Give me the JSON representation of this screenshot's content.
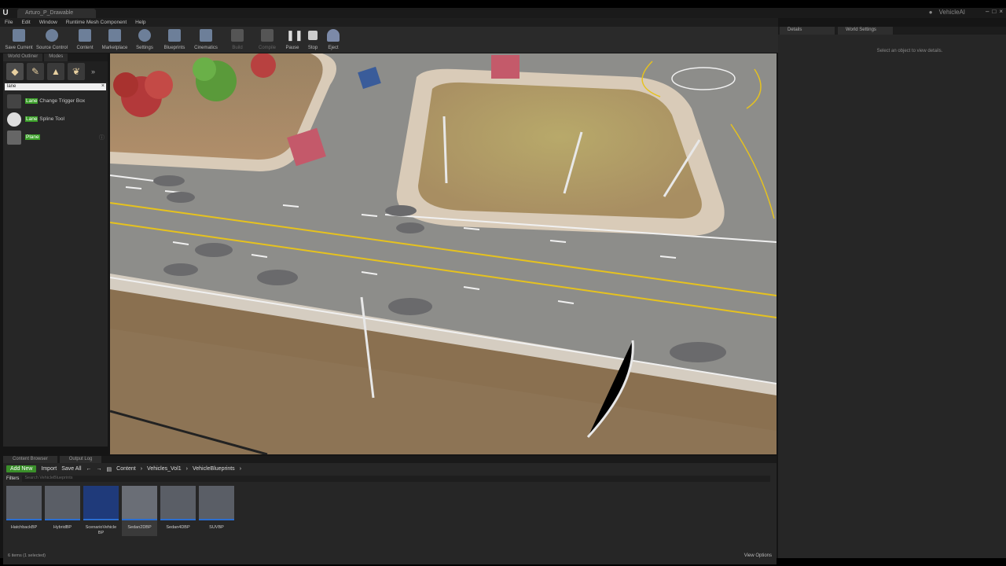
{
  "window": {
    "doc_tab": "Arturo_P_Drawable",
    "project_name": "VehicleAI"
  },
  "menu": [
    "File",
    "Edit",
    "Window",
    "Runtime Mesh Component",
    "Help"
  ],
  "toolbar": [
    {
      "label": "Save Current",
      "icon": "save-icon"
    },
    {
      "label": "Source Control",
      "icon": "source-control-icon"
    },
    {
      "label": "Content",
      "icon": "content-icon"
    },
    {
      "label": "Marketplace",
      "icon": "marketplace-icon"
    },
    {
      "label": "Settings",
      "icon": "settings-icon"
    },
    {
      "label": "Blueprints",
      "icon": "blueprints-icon"
    },
    {
      "label": "Cinematics",
      "icon": "cinematics-icon"
    },
    {
      "label": "Build",
      "icon": "build-icon",
      "disabled": true
    },
    {
      "label": "Compile",
      "icon": "compile-icon",
      "disabled": true
    },
    {
      "label": "Pause",
      "icon": "pause-icon"
    },
    {
      "label": "Stop",
      "icon": "stop-icon"
    },
    {
      "label": "Eject",
      "icon": "eject-icon"
    }
  ],
  "left_panel": {
    "tabs": [
      "World Outliner",
      "Modes"
    ],
    "search_value": "lane",
    "items": [
      {
        "highlight": "Lane",
        "rest": " Change Trigger Box"
      },
      {
        "highlight": "Lane",
        "rest": " Spline Tool"
      },
      {
        "highlight": "Plane",
        "rest": ""
      }
    ]
  },
  "details_panel": {
    "tabs": [
      "Details",
      "World Settings"
    ],
    "empty_message": "Select an object to view details."
  },
  "content_browser": {
    "tabs": [
      "Content Browser",
      "Output Log"
    ],
    "add_new": "Add New",
    "import": "Import",
    "save_all": "Save All",
    "breadcrumbs": [
      "Content",
      "Vehicles_Vol1",
      "VehicleBlueprints"
    ],
    "filters": "Filters",
    "search_placeholder": "Search VehicleBlueprints",
    "assets": [
      {
        "name": "HatchbackBP",
        "selected": false
      },
      {
        "name": "HybridBP",
        "selected": false
      },
      {
        "name": "ScenarioVehicle BP",
        "selected": false
      },
      {
        "name": "Sedan2DBP",
        "selected": true
      },
      {
        "name": "Sedan4DBP",
        "selected": false
      },
      {
        "name": "SUVBP",
        "selected": false
      }
    ],
    "status": "6 items (1 selected)",
    "view_options": "View Options"
  },
  "colors": {
    "accent_green": "#3a8f2a",
    "selection_blue": "#2a6dd0",
    "road_yellow": "#e6c21e"
  }
}
